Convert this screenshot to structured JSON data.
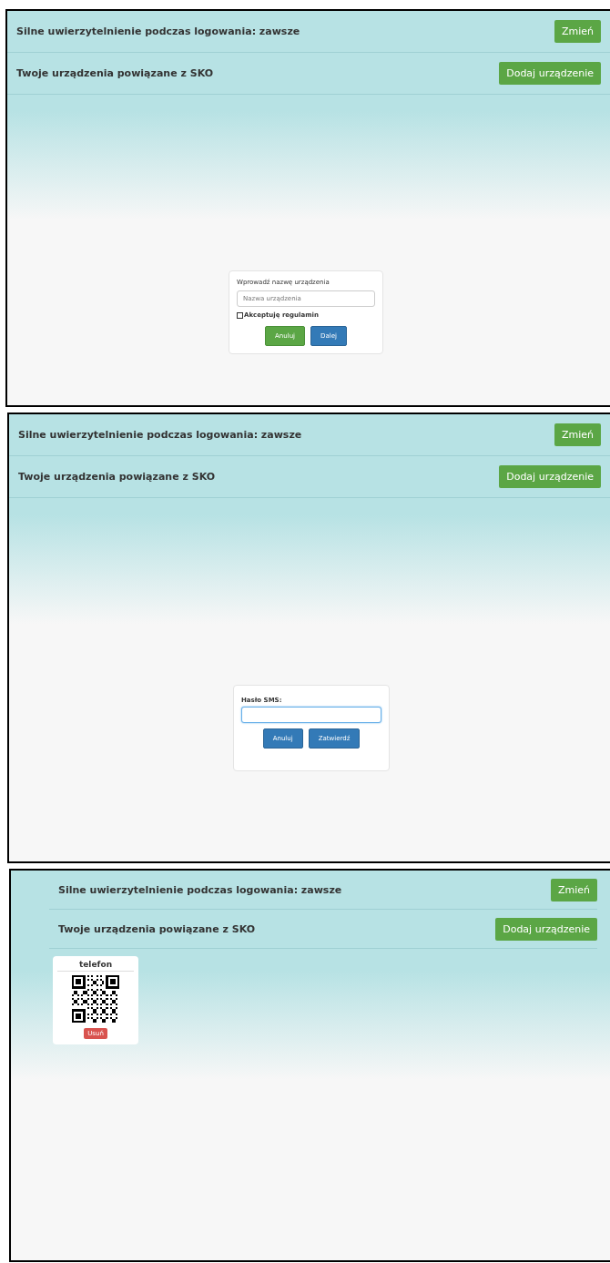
{
  "panels": [
    {
      "kind": "add-device",
      "rows": [
        {
          "label": "Silne uwierzytelnienie podczas logowania: zawsze",
          "button": "Zmień"
        },
        {
          "label": "Twoje urządzenia powiązane z SKO",
          "button": "Dodaj urządzenie"
        }
      ],
      "dialog": {
        "prompt": "Wprowadź nazwę urządzenia",
        "field": {
          "placeholder": "Nazwa urządzenia"
        },
        "checkbox": {
          "label": "Akceptuję regulamin",
          "checked": false
        },
        "buttons": [
          {
            "label": "Anuluj",
            "kind": "success"
          },
          {
            "label": "Dalej",
            "kind": "primary"
          }
        ]
      }
    },
    {
      "kind": "sms",
      "rows": [
        {
          "label": "Silne uwierzytelnienie podczas logowania: zawsze",
          "button": "Zmień"
        },
        {
          "label": "Twoje urządzenia powiązane z SKO",
          "button": "Dodaj urządzenie"
        }
      ],
      "dialog": {
        "prompt": "Hasło SMS:",
        "field": {
          "focused": true
        },
        "buttons": [
          {
            "label": "Anuluj",
            "kind": "primary"
          },
          {
            "label": "Zatwierdź",
            "kind": "primary"
          }
        ]
      }
    },
    {
      "kind": "devices",
      "rows": [
        {
          "label": "Silne uwierzytelnienie podczas logowania: zawsze",
          "button": "Zmień"
        },
        {
          "label": "Twoje urządzenia powiązane z SKO",
          "button": "Dodaj urządzenie"
        }
      ],
      "devices": [
        {
          "name": "telefon",
          "button": "Usuń"
        }
      ]
    }
  ]
}
